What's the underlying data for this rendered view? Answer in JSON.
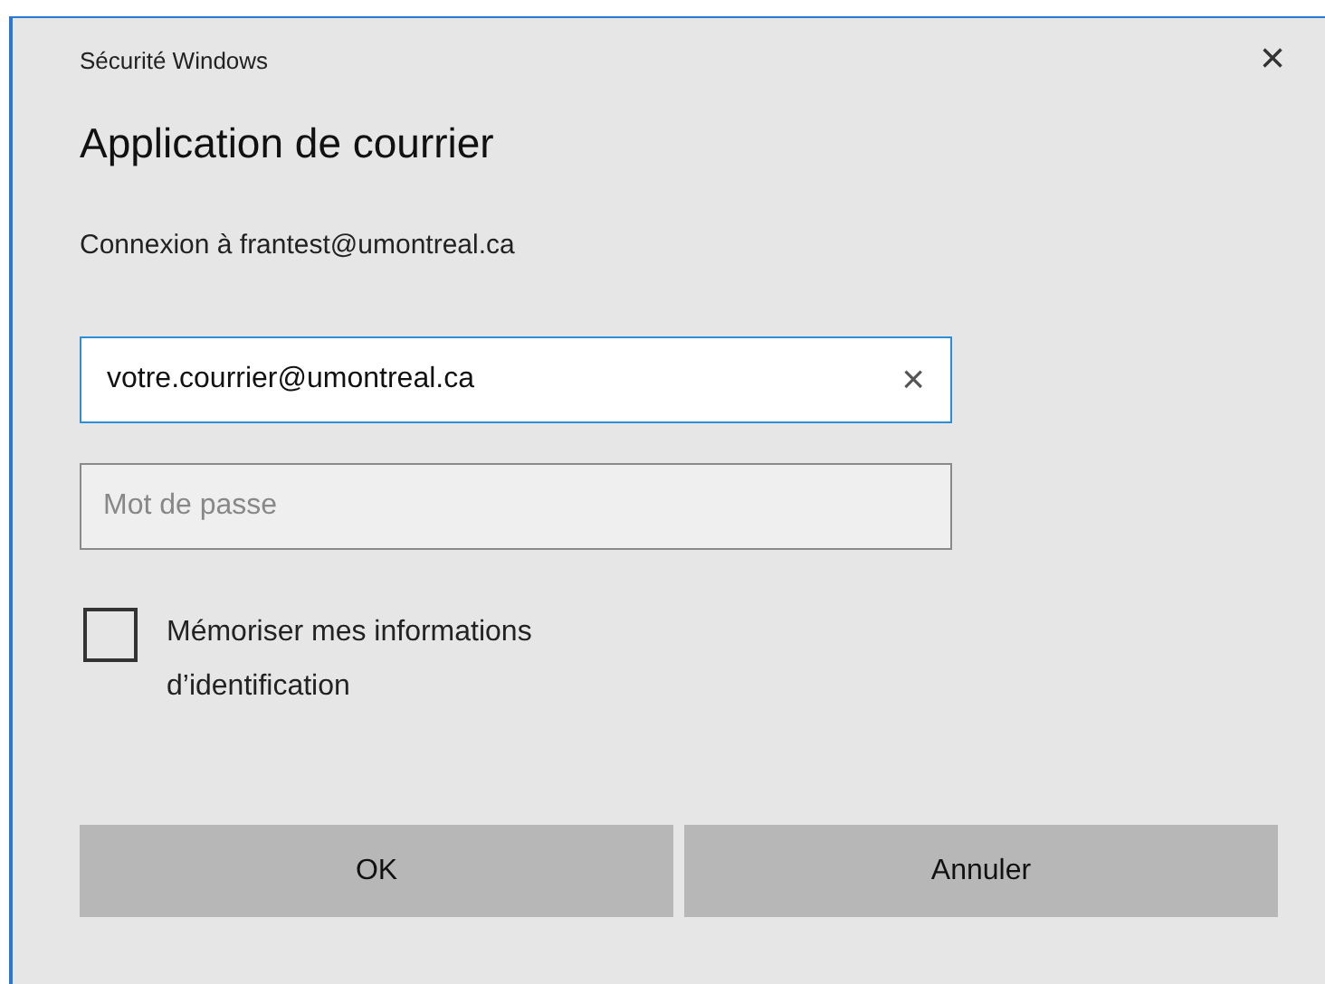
{
  "window": {
    "title": "Sécurité Windows",
    "close": "×"
  },
  "heading": "Application de courrier",
  "subtitle": "Connexion à frantest@umontreal.ca",
  "email_field": {
    "value": "votre.courrier@umontreal.ca",
    "clear": "×",
    "focused": true
  },
  "password_field": {
    "placeholder": "Mot de passe"
  },
  "remember": {
    "label": "Mémoriser mes informations d’identification",
    "checked": false
  },
  "buttons": [
    {
      "label": "OK"
    },
    {
      "label": "Annuler"
    }
  ]
}
